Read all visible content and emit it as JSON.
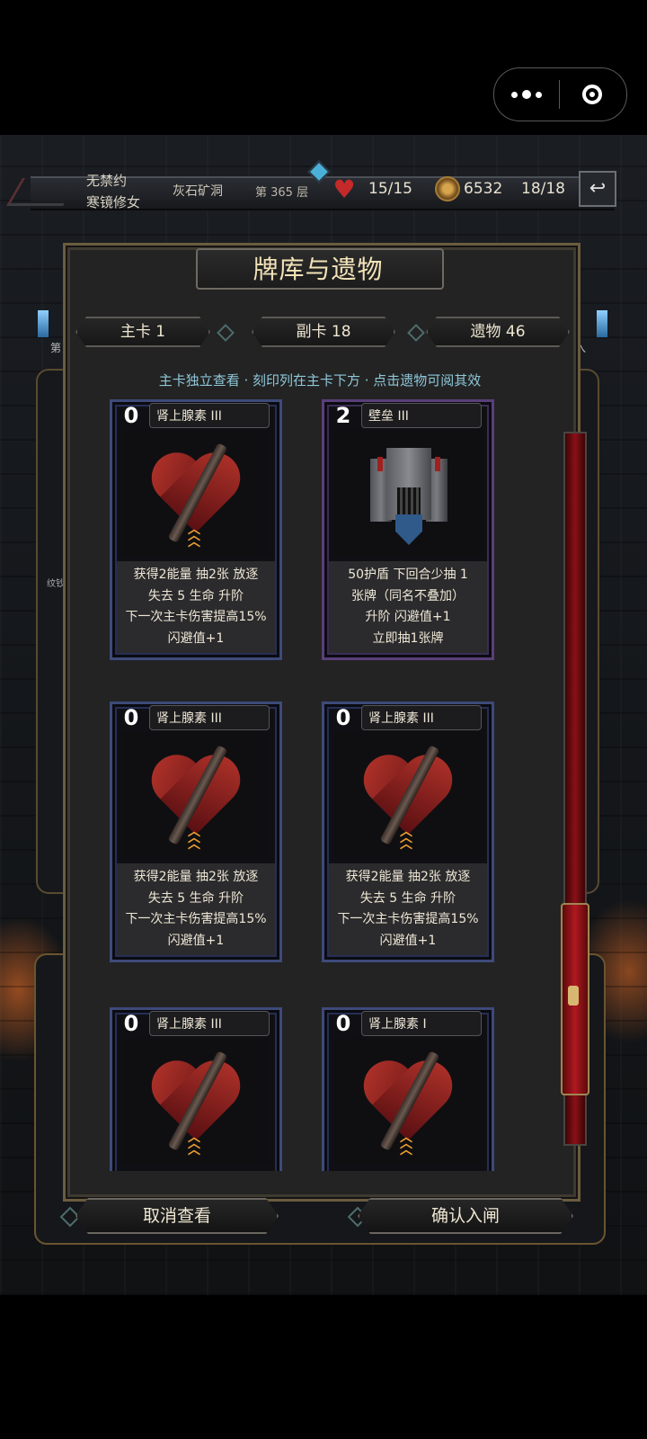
{
  "hud": {
    "line1": "无禁约",
    "line2": "寒镜修女",
    "location": "灰石矿洞",
    "floor": "第 365 层",
    "hp": "15/15",
    "gold": "6532",
    "deck_count": "18/18",
    "back_icon": "return-icon"
  },
  "panel": {
    "title": "牌库与遗物",
    "tabs": [
      {
        "label": "主卡 1"
      },
      {
        "label": "副卡 18"
      },
      {
        "label": "遗物 46"
      }
    ],
    "hint": "主卡独立查看 · 刻印列在主卡下方 · 点击遗物可阅其效"
  },
  "side": {
    "left_label": "第",
    "right_label": "入",
    "left_mid": "纹钞"
  },
  "cards": [
    {
      "cost": "0",
      "name": "肾上腺素 III",
      "art": "heart-icon",
      "frame": "blue",
      "desc": [
        "获得2能量 抽2张 放逐",
        "失去 5 生命 升阶",
        "下一次主卡伤害提高15%",
        "闪避值+1"
      ]
    },
    {
      "cost": "2",
      "name": "壁垒 III",
      "art": "castle-icon",
      "frame": "purple",
      "desc": [
        "50护盾 下回合少抽 1",
        "张牌（同名不叠加）",
        "升阶 闪避值+1",
        "立即抽1张牌"
      ]
    },
    {
      "cost": "0",
      "name": "肾上腺素 III",
      "art": "heart-icon",
      "frame": "blue",
      "desc": [
        "获得2能量 抽2张 放逐",
        "失去 5 生命 升阶",
        "下一次主卡伤害提高15%",
        "闪避值+1"
      ]
    },
    {
      "cost": "0",
      "name": "肾上腺素 III",
      "art": "heart-icon",
      "frame": "blue",
      "desc": [
        "获得2能量 抽2张 放逐",
        "失去 5 生命 升阶",
        "下一次主卡伤害提高15%",
        "闪避值+1"
      ]
    },
    {
      "cost": "0",
      "name": "肾上腺素 III",
      "art": "heart-icon",
      "frame": "blue",
      "desc": []
    },
    {
      "cost": "0",
      "name": "肾上腺素 I",
      "art": "heart-icon",
      "frame": "blue",
      "desc": []
    }
  ],
  "buttons": {
    "cancel": "取消查看",
    "confirm": "确认入闸"
  },
  "colors": {
    "title": "#f3e3b8",
    "hint": "#8ec7d8",
    "heart": "#c42a2a",
    "scrollbar": "#8a1016"
  }
}
